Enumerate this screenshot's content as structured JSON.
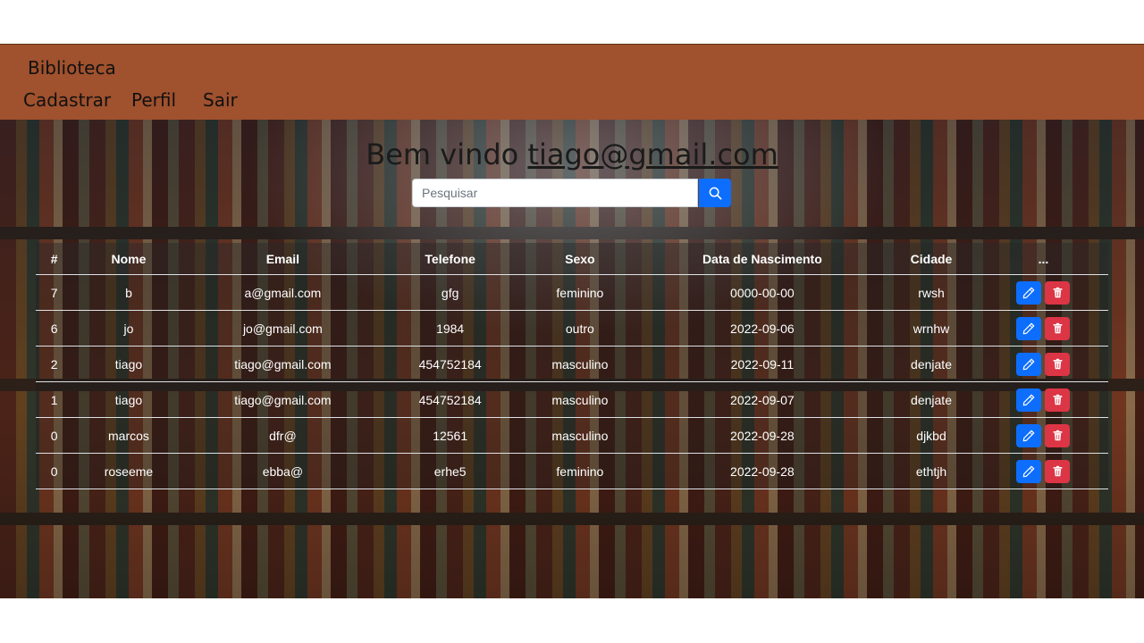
{
  "navbar": {
    "brand": "Biblioteca",
    "links": [
      "Cadastrar",
      "Perfil",
      "Sair"
    ],
    "bg_color": "#a0512d"
  },
  "welcome": {
    "prefix": "Bem vindo",
    "user_email": "tiago@gmail.com"
  },
  "search": {
    "placeholder": "Pesquisar",
    "value": "",
    "button_icon": "search-icon",
    "button_color": "#0d6efd"
  },
  "table": {
    "headers": [
      "#",
      "Nome",
      "Email",
      "Telefone",
      "Sexo",
      "Data de Nascimento",
      "Cidade",
      "..."
    ],
    "rows": [
      [
        "7",
        "b",
        "a@gmail.com",
        "gfg",
        "feminino",
        "0000-00-00",
        "rwsh"
      ],
      [
        "6",
        "jo",
        "jo@gmail.com",
        "1984",
        "outro",
        "2022-09-06",
        "wrnhw"
      ],
      [
        "2",
        "tiago",
        "tiago@gmail.com",
        "454752184",
        "masculino",
        "2022-09-11",
        "denjate"
      ],
      [
        "1",
        "tiago",
        "tiago@gmail.com",
        "454752184",
        "masculino",
        "2022-09-07",
        "denjate"
      ],
      [
        "0",
        "marcos",
        "dfr@",
        "12561",
        "masculino",
        "2022-09-28",
        "djkbd"
      ],
      [
        "0",
        "roseeme",
        "ebba@",
        "erhe5",
        "feminino",
        "2022-09-28",
        "ethtjh"
      ]
    ],
    "action_icons": [
      "pencil-icon",
      "trash-icon"
    ],
    "edit_color": "#0d6efd",
    "delete_color": "#dc3545"
  }
}
